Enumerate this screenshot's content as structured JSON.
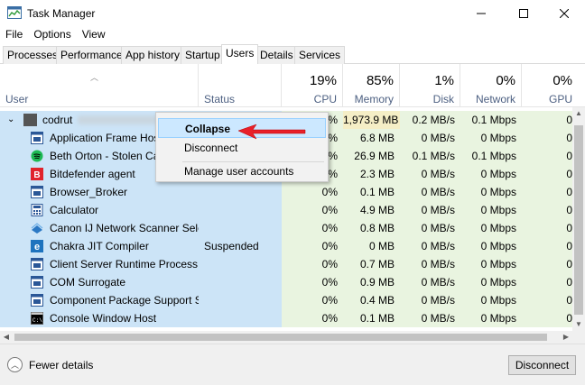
{
  "window": {
    "title": "Task Manager"
  },
  "menu": [
    "File",
    "Options",
    "View"
  ],
  "tabs": [
    "Processes",
    "Performance",
    "App history",
    "Startup",
    "Users",
    "Details",
    "Services"
  ],
  "active_tab": "Users",
  "columns": {
    "user": "User",
    "status": "Status",
    "cpu": {
      "pct": "19%",
      "label": "CPU"
    },
    "memory": {
      "pct": "85%",
      "label": "Memory"
    },
    "disk": {
      "pct": "1%",
      "label": "Disk"
    },
    "network": {
      "pct": "0%",
      "label": "Network"
    },
    "gpu": {
      "pct": "0%",
      "label": "GPU"
    }
  },
  "parent_row": {
    "user": "codrut",
    "cpu": "%",
    "memory": "1,973.9 MB",
    "disk": "0.2 MB/s",
    "network": "0.1 Mbps",
    "gpu": "0"
  },
  "rows": [
    {
      "name": "Application Frame Host",
      "status": "",
      "cpu": "%",
      "memory": "6.8 MB",
      "disk": "0 MB/s",
      "network": "0 Mbps",
      "gpu": "0",
      "icon": "app-frame-icon"
    },
    {
      "name": "Beth Orton - Stolen Car",
      "status": "",
      "cpu": "%",
      "memory": "26.9 MB",
      "disk": "0.1 MB/s",
      "network": "0.1 Mbps",
      "gpu": "0",
      "icon": "spotify-icon"
    },
    {
      "name": "Bitdefender agent",
      "status": "",
      "cpu": "%",
      "memory": "2.3 MB",
      "disk": "0 MB/s",
      "network": "0 Mbps",
      "gpu": "0",
      "icon": "bitdefender-icon"
    },
    {
      "name": "Browser_Broker",
      "status": "",
      "cpu": "0%",
      "memory": "0.1 MB",
      "disk": "0 MB/s",
      "network": "0 Mbps",
      "gpu": "0",
      "icon": "app-frame-icon"
    },
    {
      "name": "Calculator",
      "status": "",
      "cpu": "0%",
      "memory": "4.9 MB",
      "disk": "0 MB/s",
      "network": "0 Mbps",
      "gpu": "0",
      "icon": "calculator-icon"
    },
    {
      "name": "Canon IJ Network Scanner Sele...",
      "status": "",
      "cpu": "0%",
      "memory": "0.8 MB",
      "disk": "0 MB/s",
      "network": "0 Mbps",
      "gpu": "0",
      "icon": "canon-icon"
    },
    {
      "name": "Chakra JIT Compiler",
      "status": "Suspended",
      "cpu": "0%",
      "memory": "0 MB",
      "disk": "0 MB/s",
      "network": "0 Mbps",
      "gpu": "0",
      "icon": "edge-icon"
    },
    {
      "name": "Client Server Runtime Process",
      "status": "",
      "cpu": "0%",
      "memory": "0.7 MB",
      "disk": "0 MB/s",
      "network": "0 Mbps",
      "gpu": "0",
      "icon": "app-frame-icon"
    },
    {
      "name": "COM Surrogate",
      "status": "",
      "cpu": "0%",
      "memory": "0.9 MB",
      "disk": "0 MB/s",
      "network": "0 Mbps",
      "gpu": "0",
      "icon": "app-frame-icon"
    },
    {
      "name": "Component Package Support S...",
      "status": "",
      "cpu": "0%",
      "memory": "0.4 MB",
      "disk": "0 MB/s",
      "network": "0 Mbps",
      "gpu": "0",
      "icon": "app-frame-icon"
    },
    {
      "name": "Console Window Host",
      "status": "",
      "cpu": "0%",
      "memory": "0.1 MB",
      "disk": "0 MB/s",
      "network": "0 Mbps",
      "gpu": "0",
      "icon": "console-icon"
    }
  ],
  "context_menu": [
    "Collapse",
    "Disconnect",
    "Manage user accounts"
  ],
  "footer": {
    "fewer_details": "Fewer details",
    "disconnect": "Disconnect"
  }
}
